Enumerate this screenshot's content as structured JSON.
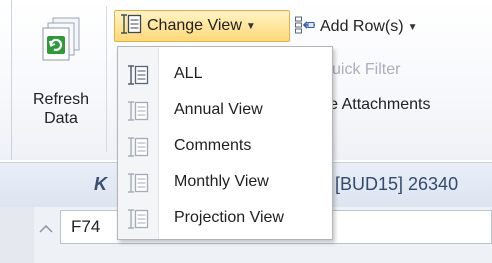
{
  "ribbon": {
    "refresh": {
      "label": "Refresh Data"
    },
    "change_view": {
      "label": "Change View"
    },
    "add_rows": {
      "label": "Add Row(s)"
    },
    "quick_filter": {
      "label": "uick Filter"
    },
    "file_attachments": {
      "label": "ile Attachments"
    }
  },
  "view_menu": {
    "items": [
      {
        "label": "ALL"
      },
      {
        "label": "Annual View"
      },
      {
        "label": "Comments"
      },
      {
        "label": "Monthly View"
      },
      {
        "label": "Projection View"
      }
    ]
  },
  "title_band": {
    "left_text": "K",
    "right_text": "[BUD15] 26340"
  },
  "grid": {
    "cell_ref": "F74"
  },
  "colors": {
    "accent_button": "#ffd978",
    "menu_border": "#b5b5b5",
    "refresh_green": "#2e9a3a"
  },
  "icons": {
    "refresh": "refresh-data-icon",
    "change_view": "view-columns-icon",
    "add_rows": "add-row-icon",
    "caret": "caret-down-icon",
    "scroll": "chevron-up-icon"
  }
}
